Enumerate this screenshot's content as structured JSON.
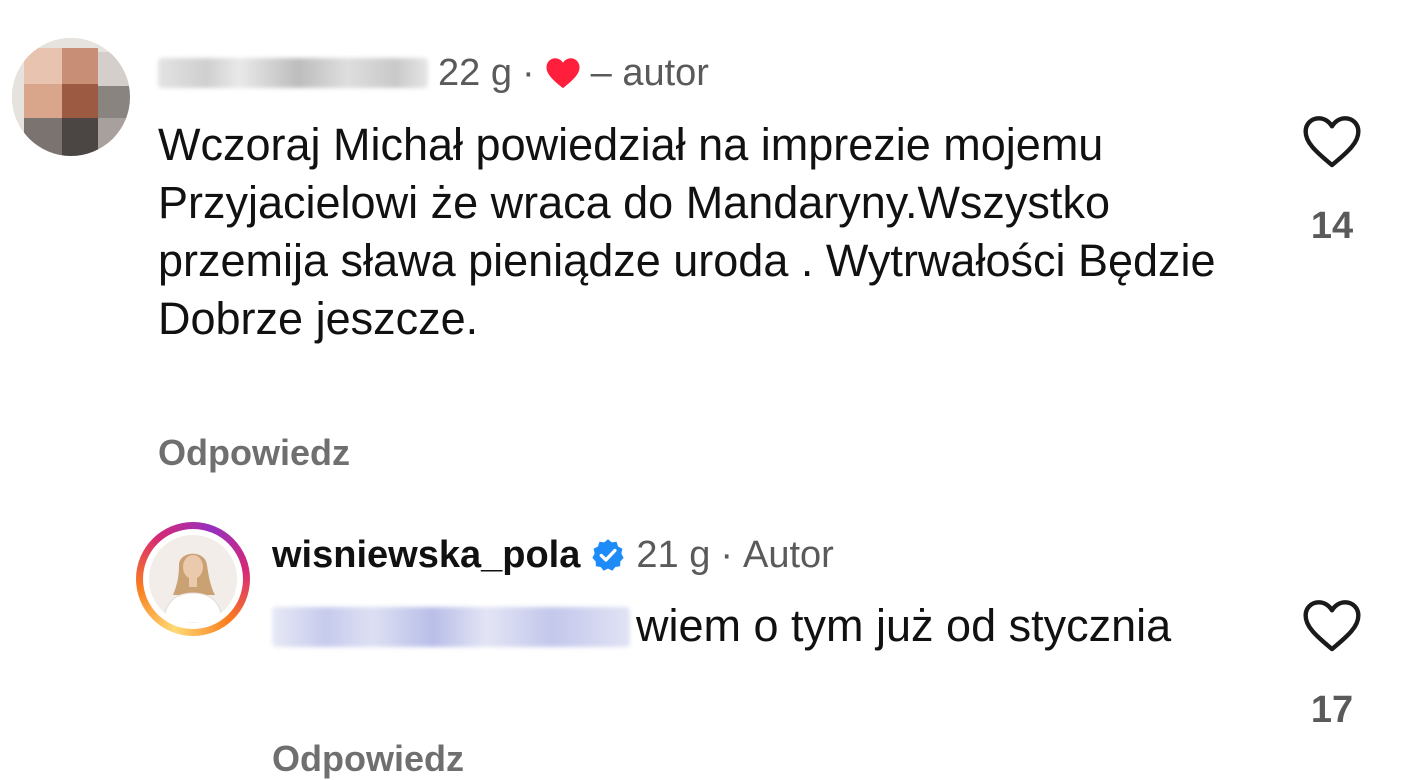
{
  "comments": [
    {
      "username": "",
      "time": "22 g",
      "author_label": "– autor",
      "text": "Wczoraj Michał powiedział na imprezie mojemu Przyjacielowi że wraca do Mandaryny.Wszystko przemija sława pieniądze uroda . Wytrwałości Będzie Dobrze jeszcze.",
      "reply_label": "Odpowiedz",
      "likes": "14",
      "liked_by_author": true,
      "username_blurred": true
    },
    {
      "username": "wisniewska_pola",
      "verified": true,
      "time": "21 g",
      "author_label": "Autor",
      "mention_blurred": true,
      "text": "wiem o tym już od stycznia",
      "reply_label": "Odpowiedz",
      "likes": "17"
    }
  ],
  "separator": "·",
  "icons": {
    "author_like": "heart-filled-icon",
    "like": "heart-outline-icon",
    "verified": "verified-badge-icon"
  },
  "colors": {
    "heart_red": "#ff1f3d",
    "verified_blue": "#1d8cf8",
    "muted_text": "#5a5a5a",
    "story_ring": [
      "#feda75",
      "#fa7e1e",
      "#d62976",
      "#962fbf"
    ]
  }
}
